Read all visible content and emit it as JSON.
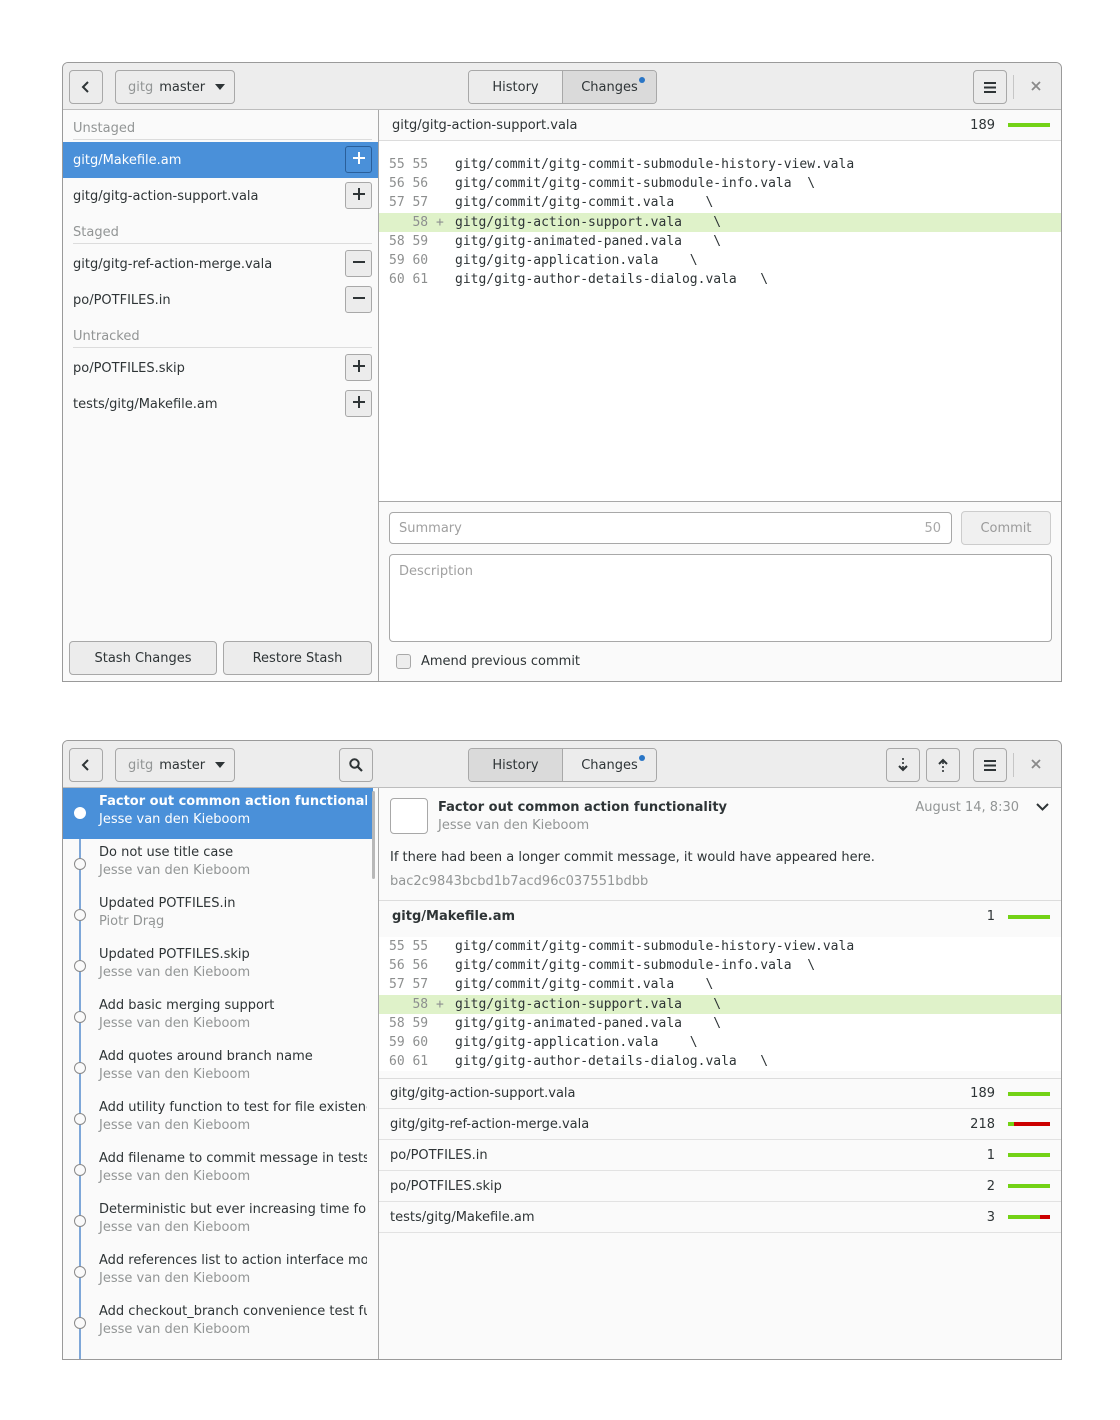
{
  "colors": {
    "accent": "#4a90d9",
    "added": "#73d216",
    "removed": "#cc0000",
    "added_line_bg": "#dff2c9",
    "indicator_dot": "#2a76c6"
  },
  "header": {
    "repo_name": "gitg",
    "branch_name": "master",
    "tabs": [
      {
        "label": "History"
      },
      {
        "label": "Changes"
      }
    ],
    "icons": {
      "back": "go-previous-icon",
      "branch_dropdown": "pan-down-icon",
      "menu": "open-menu-icon",
      "close": "window-close-icon",
      "search": "search-icon",
      "pull": "pull-icon",
      "push": "push-icon"
    }
  },
  "changes_view": {
    "active_tab": "Changes",
    "sections": [
      {
        "title": "Unstaged",
        "files": [
          {
            "path": "gitg/Makefile.am",
            "action": "+",
            "selected": true
          },
          {
            "path": "gitg/gitg-action-support.vala",
            "action": "+"
          }
        ]
      },
      {
        "title": "Staged",
        "files": [
          {
            "path": "gitg/gitg-ref-action-merge.vala",
            "action": "−"
          },
          {
            "path": "po/POTFILES.in",
            "action": "−"
          }
        ]
      },
      {
        "title": "Untracked",
        "files": [
          {
            "path": "po/POTFILES.skip",
            "action": "+"
          },
          {
            "path": "tests/gitg/Makefile.am",
            "action": "+"
          }
        ]
      }
    ],
    "stash_label": "Stash Changes",
    "restore_stash_label": "Restore Stash",
    "diff_file": {
      "path": "gitg/gitg-action-support.vala",
      "count": "189",
      "added_fraction": 1.0
    },
    "diff_lines": [
      {
        "old": "55",
        "new": "55",
        "sign": " ",
        "text": "gitg/commit/gitg-commit-submodule-history-view.vala",
        "type": "context"
      },
      {
        "old": "56",
        "new": "56",
        "sign": " ",
        "text": "gitg/commit/gitg-commit-submodule-info.vala  \\",
        "type": "context"
      },
      {
        "old": "57",
        "new": "57",
        "sign": " ",
        "text": "gitg/commit/gitg-commit.vala    \\",
        "type": "context"
      },
      {
        "old": "  ",
        "new": "58",
        "sign": "+",
        "text": "gitg/gitg-action-support.vala    \\",
        "type": "added"
      },
      {
        "old": "58",
        "new": "59",
        "sign": " ",
        "text": "gitg/gitg-animated-paned.vala    \\",
        "type": "context"
      },
      {
        "old": "59",
        "new": "60",
        "sign": " ",
        "text": "gitg/gitg-application.vala    \\",
        "type": "context"
      },
      {
        "old": "60",
        "new": "61",
        "sign": " ",
        "text": "gitg/gitg-author-details-dialog.vala   \\",
        "type": "context"
      }
    ],
    "commit_form": {
      "summary_placeholder": "Summary",
      "summary_remaining": "50",
      "commit_label": "Commit",
      "description_placeholder": "Description",
      "amend_label": "Amend previous commit",
      "amend_checked": false
    }
  },
  "history_view": {
    "active_tab": "History",
    "commits": [
      {
        "subject": "Factor out common action functionality",
        "author": "Jesse van den Kieboom",
        "selected": true
      },
      {
        "subject": "Do not use title case",
        "author": "Jesse van den Kieboom"
      },
      {
        "subject": "Updated POTFILES.in",
        "author": "Piotr Drąg"
      },
      {
        "subject": "Updated POTFILES.skip",
        "author": "Jesse van den Kieboom"
      },
      {
        "subject": "Add basic merging support",
        "author": "Jesse van den Kieboom"
      },
      {
        "subject": "Add quotes around branch name",
        "author": "Jesse van den Kieboom"
      },
      {
        "subject": "Add utility function to test for file existence",
        "author": "Jesse van den Kieboom"
      },
      {
        "subject": "Add filename to commit message in tests",
        "author": "Jesse van den Kieboom"
      },
      {
        "subject": "Deterministic but ever increasing time for t…",
        "author": "Jesse van den Kieboom"
      },
      {
        "subject": "Add references list to action interface mock",
        "author": "Jesse van den Kieboom"
      },
      {
        "subject": "Add checkout_branch convenience test fun…",
        "author": "Jesse van den Kieboom"
      }
    ],
    "detail": {
      "subject": "Factor out common action functionality",
      "author": "Jesse van den Kieboom",
      "date": "August 14, 8:30",
      "message": "If there had been a longer commit message, it would have appeared here.",
      "sha": "bac2c9843bcbd1b7acd96c037551bdbb",
      "expanded_file": {
        "path": "gitg/Makefile.am",
        "count": "1",
        "added_fraction": 1.0
      },
      "files": [
        {
          "path": "gitg/gitg-action-support.vala",
          "count": "189",
          "added_fraction": 1.0
        },
        {
          "path": "gitg/gitg-ref-action-merge.vala",
          "count": "218",
          "added_fraction": 0.15
        },
        {
          "path": "po/POTFILES.in",
          "count": "1",
          "added_fraction": 1.0
        },
        {
          "path": "po/POTFILES.skip",
          "count": "2",
          "added_fraction": 1.0
        },
        {
          "path": "tests/gitg/Makefile.am",
          "count": "3",
          "added_fraction": 0.75
        }
      ]
    }
  }
}
